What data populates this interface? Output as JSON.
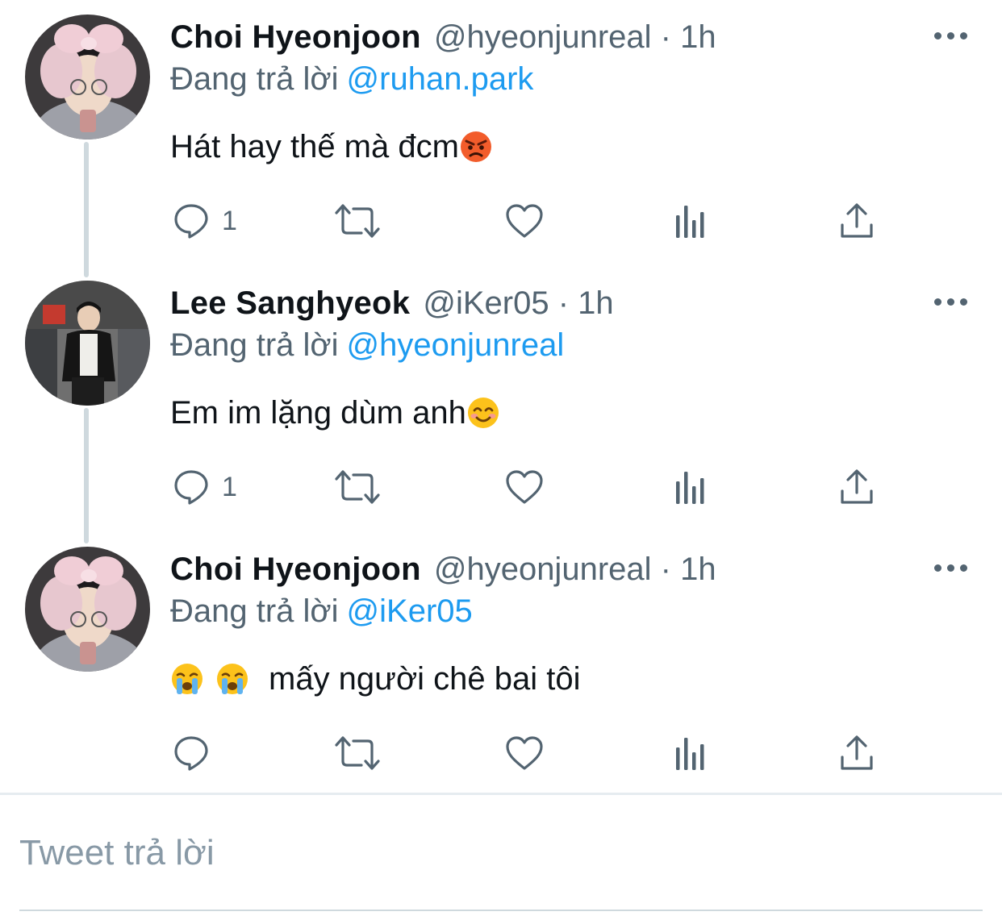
{
  "thread": [
    {
      "name": "Choi Hyeonjoon",
      "handle": "@hyeonjunreal",
      "time": "· 1h",
      "reply_prefix": "Đang trả lời",
      "reply_to": "@ruhan.park",
      "text": "Hát hay thế mà đcm",
      "emojis_after": [
        "angry-face"
      ],
      "reply_count": "1"
    },
    {
      "name": "Lee Sanghyeok",
      "handle": "@iKer05",
      "time": "· 1h",
      "reply_prefix": "Đang trả lời",
      "reply_to": "@hyeonjunreal",
      "text": "Em im lặng dùm anh",
      "emojis_after": [
        "smiling-face"
      ],
      "reply_count": "1"
    },
    {
      "name": "Choi Hyeonjoon",
      "handle": "@hyeonjunreal",
      "time": "· 1h",
      "reply_prefix": "Đang trả lời",
      "reply_to": "@iKer05",
      "text": "mấy người chê bai tôi",
      "emojis_before": [
        "crying-face",
        "crying-face"
      ],
      "reply_count": ""
    }
  ],
  "compose": {
    "placeholder": "Tweet trả lời"
  },
  "colors": {
    "accent": "#1d9bf0",
    "secondary_text": "#536471",
    "placeholder": "#8899a6",
    "thread_line": "#cfd9de"
  },
  "icons": [
    "comment-icon",
    "retweet-icon",
    "like-icon",
    "analytics-icon",
    "share-icon",
    "more-icon"
  ]
}
